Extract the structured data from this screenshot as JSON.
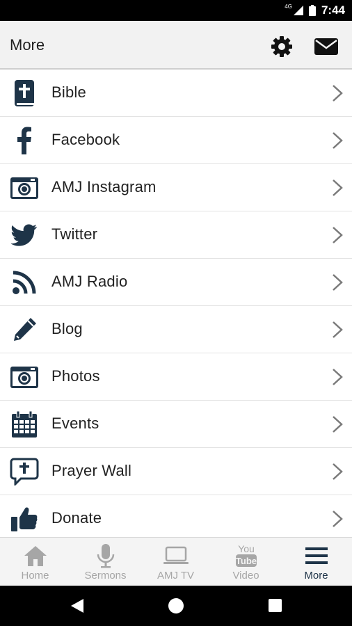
{
  "status_bar": {
    "network": "4G",
    "time": "7:44"
  },
  "header": {
    "title": "More"
  },
  "colors": {
    "icon": "#1e3448",
    "chevron": "#7a7a7a",
    "tab_inactive": "#a6a6a6"
  },
  "menu_items": [
    {
      "label": "Bible",
      "icon": "bible-icon"
    },
    {
      "label": "Facebook",
      "icon": "facebook-icon"
    },
    {
      "label": "AMJ Instagram",
      "icon": "camera-icon"
    },
    {
      "label": "Twitter",
      "icon": "twitter-icon"
    },
    {
      "label": "AMJ Radio",
      "icon": "rss-icon"
    },
    {
      "label": "Blog",
      "icon": "pencil-icon"
    },
    {
      "label": "Photos",
      "icon": "camera-icon"
    },
    {
      "label": "Events",
      "icon": "calendar-icon"
    },
    {
      "label": "Prayer Wall",
      "icon": "prayer-bubble-icon"
    },
    {
      "label": "Donate",
      "icon": "thumbs-up-icon"
    }
  ],
  "tabs": [
    {
      "label": "Home",
      "icon": "home-icon",
      "active": false
    },
    {
      "label": "Sermons",
      "icon": "microphone-icon",
      "active": false
    },
    {
      "label": "AMJ TV",
      "icon": "laptop-icon",
      "active": false
    },
    {
      "label": "Video",
      "icon": "youtube-icon",
      "youtube_top": "You",
      "youtube_bottom": "Tube",
      "active": false
    },
    {
      "label": "More",
      "icon": "menu-icon",
      "active": true
    }
  ]
}
